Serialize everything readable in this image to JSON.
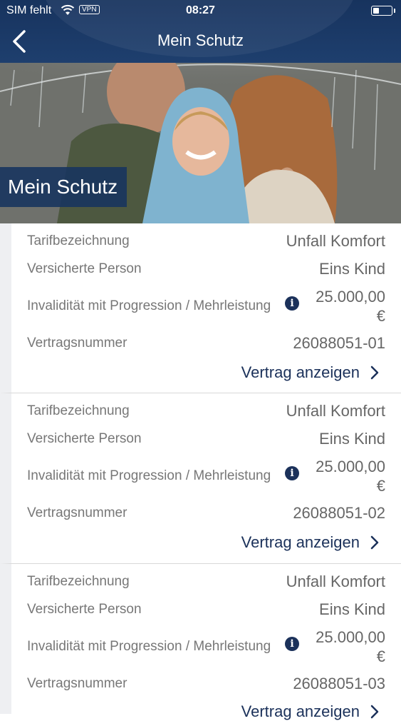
{
  "status_bar": {
    "carrier": "SIM fehlt",
    "vpn": "VPN",
    "time": "08:27",
    "wifi_icon": "wifi-icon",
    "battery_icon": "battery-icon"
  },
  "nav": {
    "title": "Mein Schutz",
    "back_icon": "chevron-left-icon"
  },
  "hero": {
    "label": "Mein Schutz"
  },
  "contracts": [
    {
      "tariff_label": "Tarifbezeichnung",
      "tariff": "Unfall Komfort",
      "person_label": "Versicherte Person",
      "person": "Eins Kind",
      "invalidity_label": "Invalidität mit Progression / Mehrleistung",
      "invalidity": "25.000,00 €",
      "contract_no_label": "Vertragsnummer",
      "contract_no": "26088051-01",
      "link": "Vertrag anzeigen"
    },
    {
      "tariff_label": "Tarifbezeichnung",
      "tariff": "Unfall Komfort",
      "person_label": "Versicherte Person",
      "person": "Eins Kind",
      "invalidity_label": "Invalidität mit Progression / Mehrleistung",
      "invalidity": "25.000,00 €",
      "contract_no_label": "Vertragsnummer",
      "contract_no": "26088051-02",
      "link": "Vertrag anzeigen"
    },
    {
      "tariff_label": "Tarifbezeichnung",
      "tariff": "Unfall Komfort",
      "person_label": "Versicherte Person",
      "person": "Eins Kind",
      "invalidity_label": "Invalidität mit Progression / Mehrleistung",
      "invalidity": "25.000,00 €",
      "contract_no_label": "Vertragsnummer",
      "contract_no": "26088051-03",
      "link": "Vertrag anzeigen"
    }
  ],
  "colors": {
    "header": "#1e3f6e",
    "accent": "#1b315a",
    "label_text": "#777777"
  }
}
